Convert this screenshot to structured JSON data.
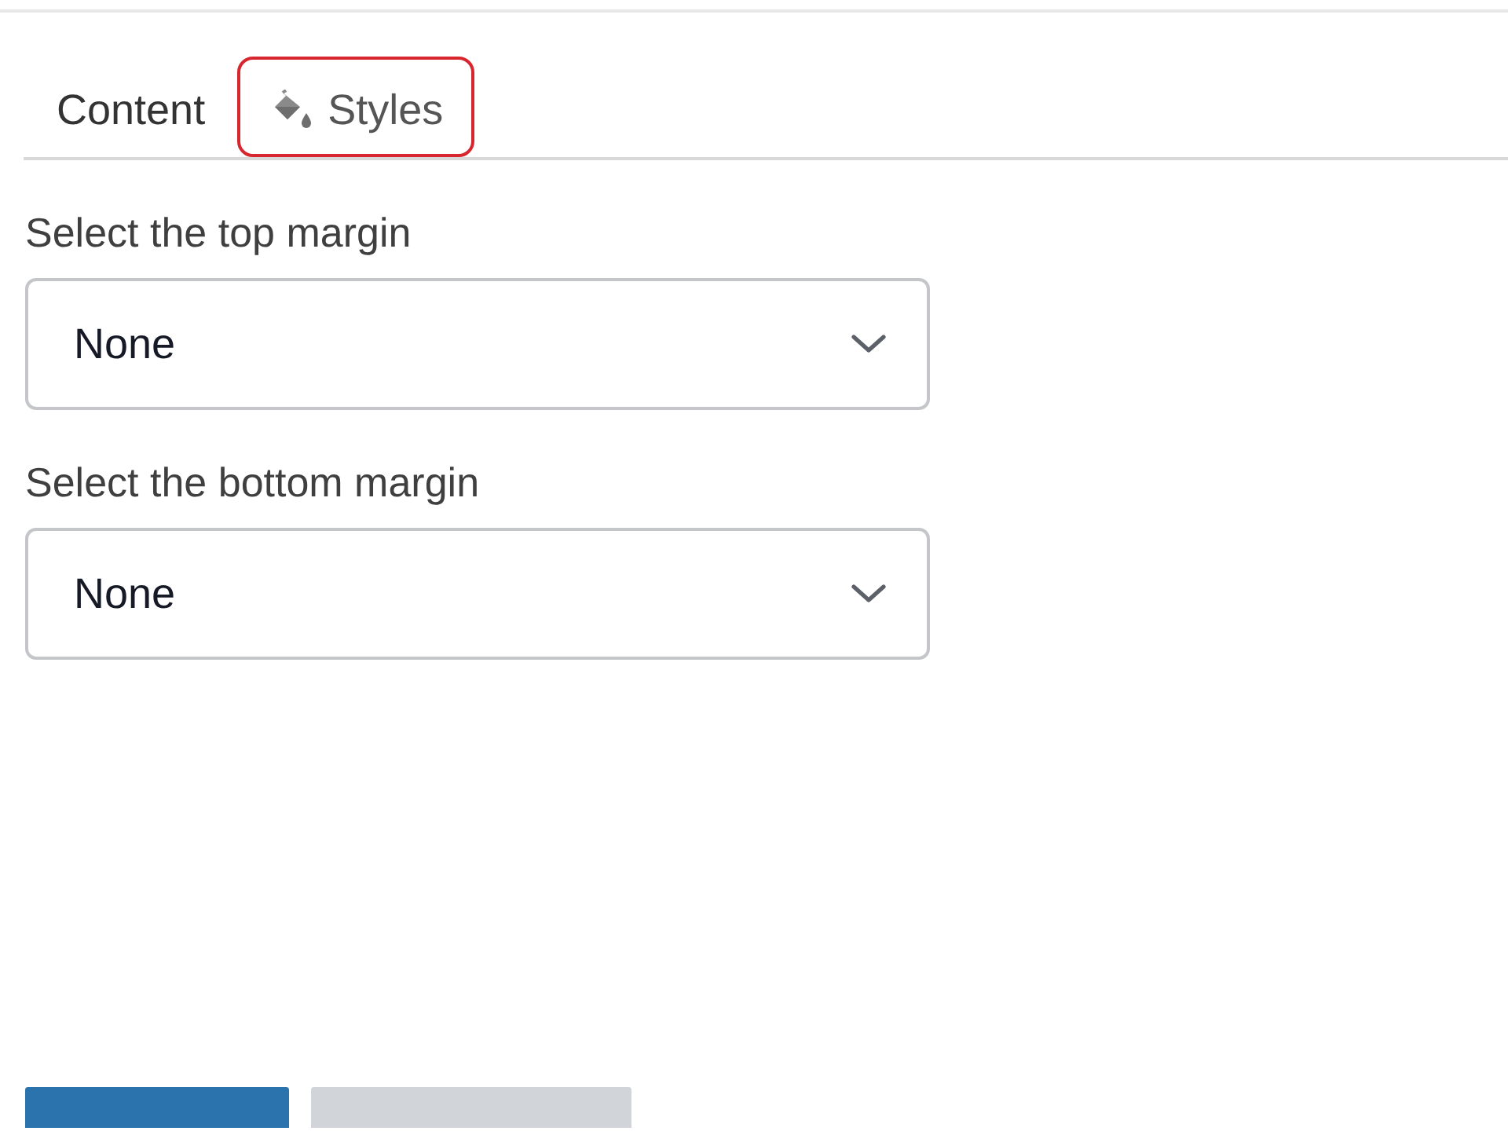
{
  "tabs": [
    {
      "label": "Content",
      "selected": false,
      "kind": "plain"
    },
    {
      "label": "Styles",
      "selected": true,
      "kind": "icon"
    }
  ],
  "fields": [
    {
      "label": "Select the top margin",
      "value": "None"
    },
    {
      "label": "Select the bottom margin",
      "value": "None"
    }
  ],
  "buttons": [
    {
      "kind": "primary"
    },
    {
      "kind": "secondary"
    }
  ]
}
